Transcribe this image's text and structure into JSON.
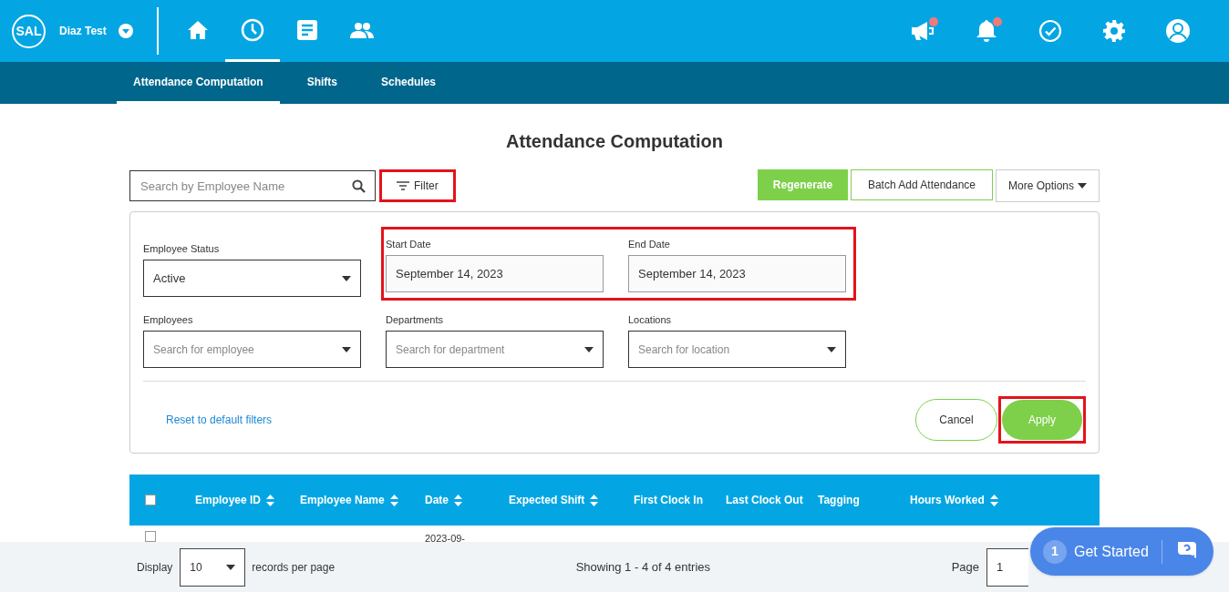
{
  "header": {
    "logo": "SAL",
    "company": "Diaz Test",
    "nav": [
      {
        "selected": false
      },
      {
        "selected": true
      },
      {
        "selected": false
      },
      {
        "selected": false
      }
    ],
    "actions": [
      {
        "badge": true
      },
      {
        "badge": true
      },
      {
        "badge": false
      },
      {
        "badge": false
      },
      {
        "badge": false
      }
    ]
  },
  "tabs": [
    {
      "label": "Attendance Computation",
      "selected": true
    },
    {
      "label": "Shifts",
      "selected": false
    },
    {
      "label": "Schedules",
      "selected": false
    }
  ],
  "title": "Attendance Computation",
  "toolbar": {
    "search_placeholder": "Search by Employee Name",
    "filter": "Filter",
    "buttons": [
      {
        "label": "Regenerate",
        "kind": "primary"
      },
      {
        "label": "Batch Add Attendance",
        "kind": "outline"
      },
      {
        "label": "More Options",
        "kind": "dropdown"
      }
    ]
  },
  "filters": [
    {
      "label": "Employee Status",
      "kind": "select",
      "value": "Active"
    },
    {
      "label": "Start Date",
      "kind": "date",
      "value": "September 14, 2023"
    },
    {
      "label": "End Date",
      "kind": "date",
      "value": "September 14, 2023"
    },
    {
      "label": "Employees",
      "kind": "select",
      "placeholder": "Search for employee"
    },
    {
      "label": "Departments",
      "kind": "select",
      "placeholder": "Search for department"
    },
    {
      "label": "Locations",
      "kind": "select",
      "placeholder": "Search for location"
    }
  ],
  "filter_actions": {
    "reset": "Reset to default filters",
    "cancel": "Cancel",
    "apply": "Apply"
  },
  "table": {
    "columns": [
      {
        "label": "Employee ID",
        "sortable": true
      },
      {
        "label": "Employee Name",
        "sortable": true
      },
      {
        "label": "Date",
        "sortable": true
      },
      {
        "label": "Expected Shift",
        "sortable": true
      },
      {
        "label": "First Clock In",
        "sortable": false
      },
      {
        "label": "Last Clock Out",
        "sortable": false
      },
      {
        "label": "Tagging",
        "sortable": false
      },
      {
        "label": "Hours Worked",
        "sortable": true
      }
    ],
    "all_checked": false,
    "rows": [
      {
        "checked": false,
        "date": "2023-09-"
      }
    ]
  },
  "footer": {
    "display": "Display",
    "page_size": "10",
    "records": "records per page",
    "showing": "Showing 1 - 4 of 4 entries",
    "page_label": "Page",
    "page": "1"
  },
  "get_started": {
    "count": "1",
    "label": "Get Started"
  }
}
